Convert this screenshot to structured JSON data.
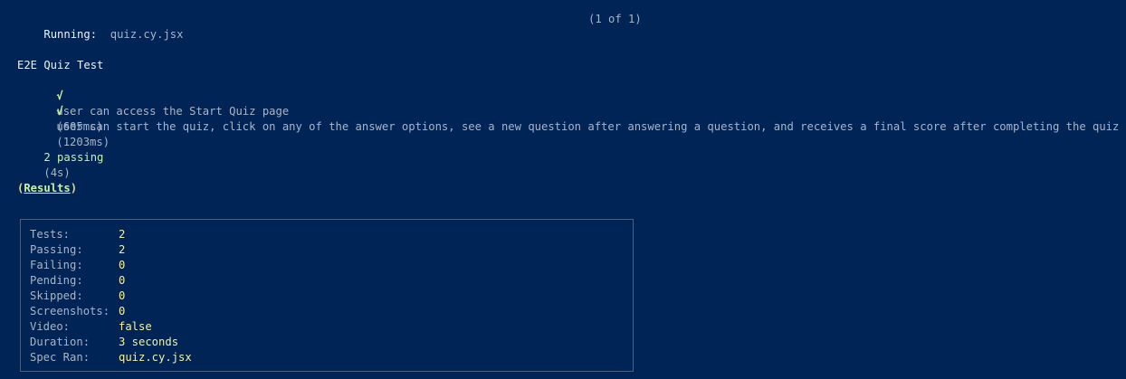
{
  "header": {
    "running_label": "Running:",
    "spec_name": "quiz.cy.jsx",
    "counter": "(1 of 1)"
  },
  "suite": {
    "title": "E2E Quiz Test",
    "tests": [
      {
        "check": "√",
        "text": "user can access the Start Quiz page",
        "time": "(605ms)"
      },
      {
        "check": "√",
        "text": "user can start the quiz, click on any of the answer options, see a new question after answering a question, and receives a final score after completing the quiz",
        "time": "(1203ms)"
      }
    ]
  },
  "summary": {
    "passing_text": "2 passing",
    "duration": "(4s)"
  },
  "results_heading": {
    "open": "(",
    "label": "Results",
    "close": ")"
  },
  "results": [
    {
      "key": "Tests:",
      "value": "2"
    },
    {
      "key": "Passing:",
      "value": "2"
    },
    {
      "key": "Failing:",
      "value": "0"
    },
    {
      "key": "Pending:",
      "value": "0"
    },
    {
      "key": "Skipped:",
      "value": "0"
    },
    {
      "key": "Screenshots:",
      "value": "0"
    },
    {
      "key": "Video:",
      "value": "false"
    },
    {
      "key": "Duration:",
      "value": "3 seconds"
    },
    {
      "key": "Spec Ran:",
      "value": "quiz.cy.jsx"
    }
  ]
}
